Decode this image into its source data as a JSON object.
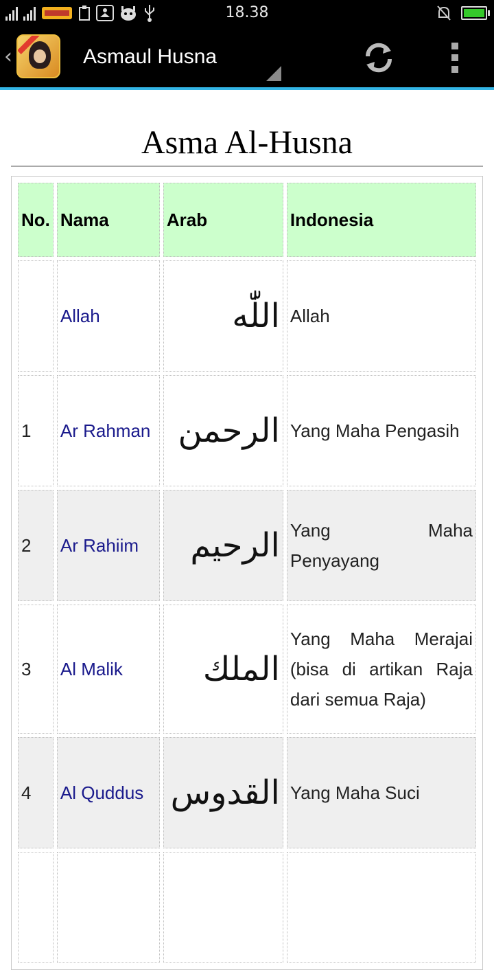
{
  "status_bar": {
    "time": "18.38",
    "icons_left": [
      "signal-1-icon",
      "signal-2-icon",
      "lottery-app-icon",
      "clipboard-icon",
      "meditation-app-icon",
      "android-icon",
      "usb-icon"
    ],
    "icons_right": [
      "mute-notification-icon",
      "battery-charging-icon"
    ],
    "battery_color": "#35c92a"
  },
  "action_bar": {
    "title": "Asmaul Husna",
    "accent_color": "#33b5e5"
  },
  "page": {
    "title": "Asma Al-Husna",
    "table": {
      "headers": [
        "No.",
        "Nama",
        "Arab",
        "Indonesia"
      ],
      "header_bg": "#ccffcc",
      "rows": [
        {
          "no": "",
          "nama": "Allah",
          "arab": "اللّٰه",
          "indonesia": "Allah"
        },
        {
          "no": "1",
          "nama": "Ar Rahman",
          "arab": "الرحمن",
          "indonesia": "Yang Maha Pengasih"
        },
        {
          "no": "2",
          "nama": "Ar Rahiim",
          "arab": "الرحيم",
          "indonesia": "Yang Maha Penyayang"
        },
        {
          "no": "3",
          "nama": "Al Malik",
          "arab": "الملك",
          "indonesia": "Yang Maha Merajai (bisa di artikan Raja dari semua Raja)"
        },
        {
          "no": "4",
          "nama": "Al Quddus",
          "arab": "القدوس",
          "indonesia": "Yang Maha Suci"
        }
      ]
    }
  }
}
